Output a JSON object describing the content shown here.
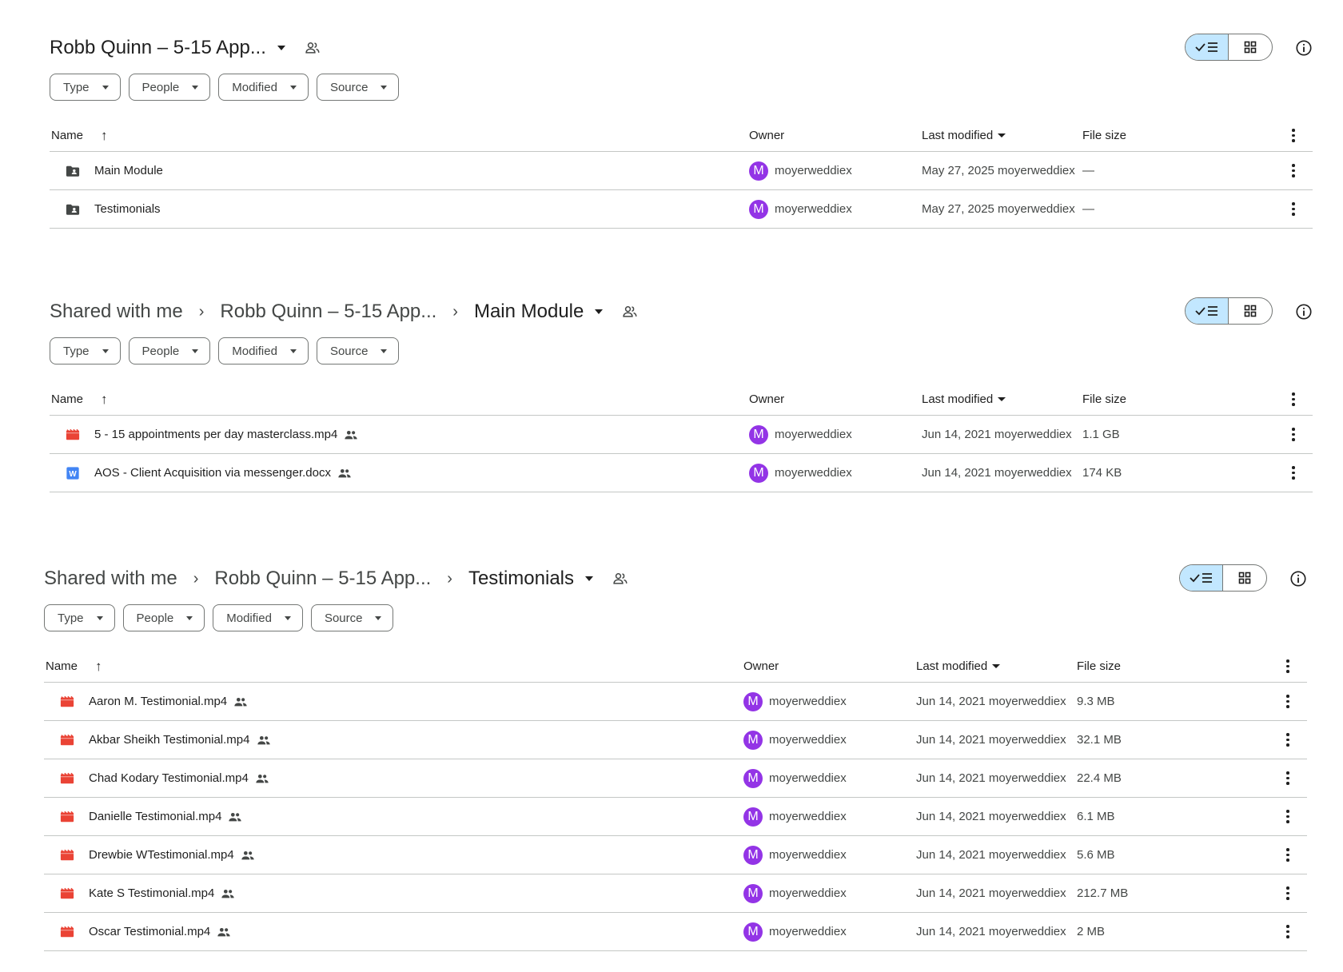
{
  "filters": [
    "Type",
    "People",
    "Modified",
    "Source"
  ],
  "columns": {
    "name": "Name",
    "owner": "Owner",
    "modified": "Last modified",
    "size": "File size"
  },
  "avatar_letter": "M",
  "colors": {
    "accent_toggle": "#c2e7ff",
    "avatar": "#9334e6",
    "video_icon": "#ea4335",
    "doc_icon": "#4285f4"
  },
  "panels": [
    {
      "breadcrumbs": [],
      "current": "Robb Quinn – 5-15 App...",
      "rows": [
        {
          "icon": "shared-folder-icon",
          "name": "Main Module",
          "shared": false,
          "owner": "moyerweddiex",
          "modified": "May 27, 2025 moyerweddiex",
          "size": "—"
        },
        {
          "icon": "shared-folder-icon",
          "name": "Testimonials",
          "shared": false,
          "owner": "moyerweddiex",
          "modified": "May 27, 2025 moyerweddiex",
          "size": "—"
        }
      ]
    },
    {
      "breadcrumbs": [
        "Shared with me",
        "Robb Quinn – 5-15 App..."
      ],
      "current": "Main Module",
      "rows": [
        {
          "icon": "video-file-icon",
          "name": "5 - 15 appointments per day masterclass.mp4",
          "shared": true,
          "owner": "moyerweddiex",
          "modified": "Jun 14, 2021 moyerweddiex",
          "size": "1.1 GB"
        },
        {
          "icon": "word-doc-icon",
          "name": "AOS - Client Acquisition via messenger.docx",
          "shared": true,
          "owner": "moyerweddiex",
          "modified": "Jun 14, 2021 moyerweddiex",
          "size": "174 KB"
        }
      ]
    },
    {
      "breadcrumbs": [
        "Shared with me",
        "Robb Quinn – 5-15 App..."
      ],
      "current": "Testimonials",
      "rows": [
        {
          "icon": "video-file-icon",
          "name": "Aaron M. Testimonial.mp4",
          "shared": true,
          "owner": "moyerweddiex",
          "modified": "Jun 14, 2021 moyerweddiex",
          "size": "9.3 MB"
        },
        {
          "icon": "video-file-icon",
          "name": "Akbar Sheikh Testimonial.mp4",
          "shared": true,
          "owner": "moyerweddiex",
          "modified": "Jun 14, 2021 moyerweddiex",
          "size": "32.1 MB"
        },
        {
          "icon": "video-file-icon",
          "name": "Chad Kodary Testimonial.mp4",
          "shared": true,
          "owner": "moyerweddiex",
          "modified": "Jun 14, 2021 moyerweddiex",
          "size": "22.4 MB"
        },
        {
          "icon": "video-file-icon",
          "name": "Danielle Testimonial.mp4",
          "shared": true,
          "owner": "moyerweddiex",
          "modified": "Jun 14, 2021 moyerweddiex",
          "size": "6.1 MB"
        },
        {
          "icon": "video-file-icon",
          "name": "Drewbie WTestimonial.mp4",
          "shared": true,
          "owner": "moyerweddiex",
          "modified": "Jun 14, 2021 moyerweddiex",
          "size": "5.6 MB"
        },
        {
          "icon": "video-file-icon",
          "name": "Kate S Testimonial.mp4",
          "shared": true,
          "owner": "moyerweddiex",
          "modified": "Jun 14, 2021 moyerweddiex",
          "size": "212.7 MB"
        },
        {
          "icon": "video-file-icon",
          "name": "Oscar Testimonial.mp4",
          "shared": true,
          "owner": "moyerweddiex",
          "modified": "Jun 14, 2021 moyerweddiex",
          "size": "2 MB"
        }
      ]
    }
  ]
}
